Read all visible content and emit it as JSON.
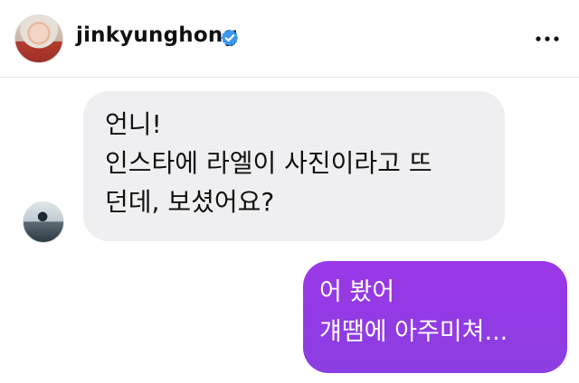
{
  "header": {
    "username": "jinkyunghong",
    "verified_icon": "verified-badge-icon",
    "more_icon": "more-options-icon"
  },
  "messages": {
    "incoming": {
      "text": "언니!\n인스타에 라엘이 사진이라고 뜨\n던데, 보셨어요?"
    },
    "outgoing": {
      "text": "어 봤어\n걔땜에 아주미쳐..."
    }
  },
  "colors": {
    "accent": "#8b3ee2",
    "incoming_bubble": "#efeff1",
    "verified": "#3897f0"
  }
}
